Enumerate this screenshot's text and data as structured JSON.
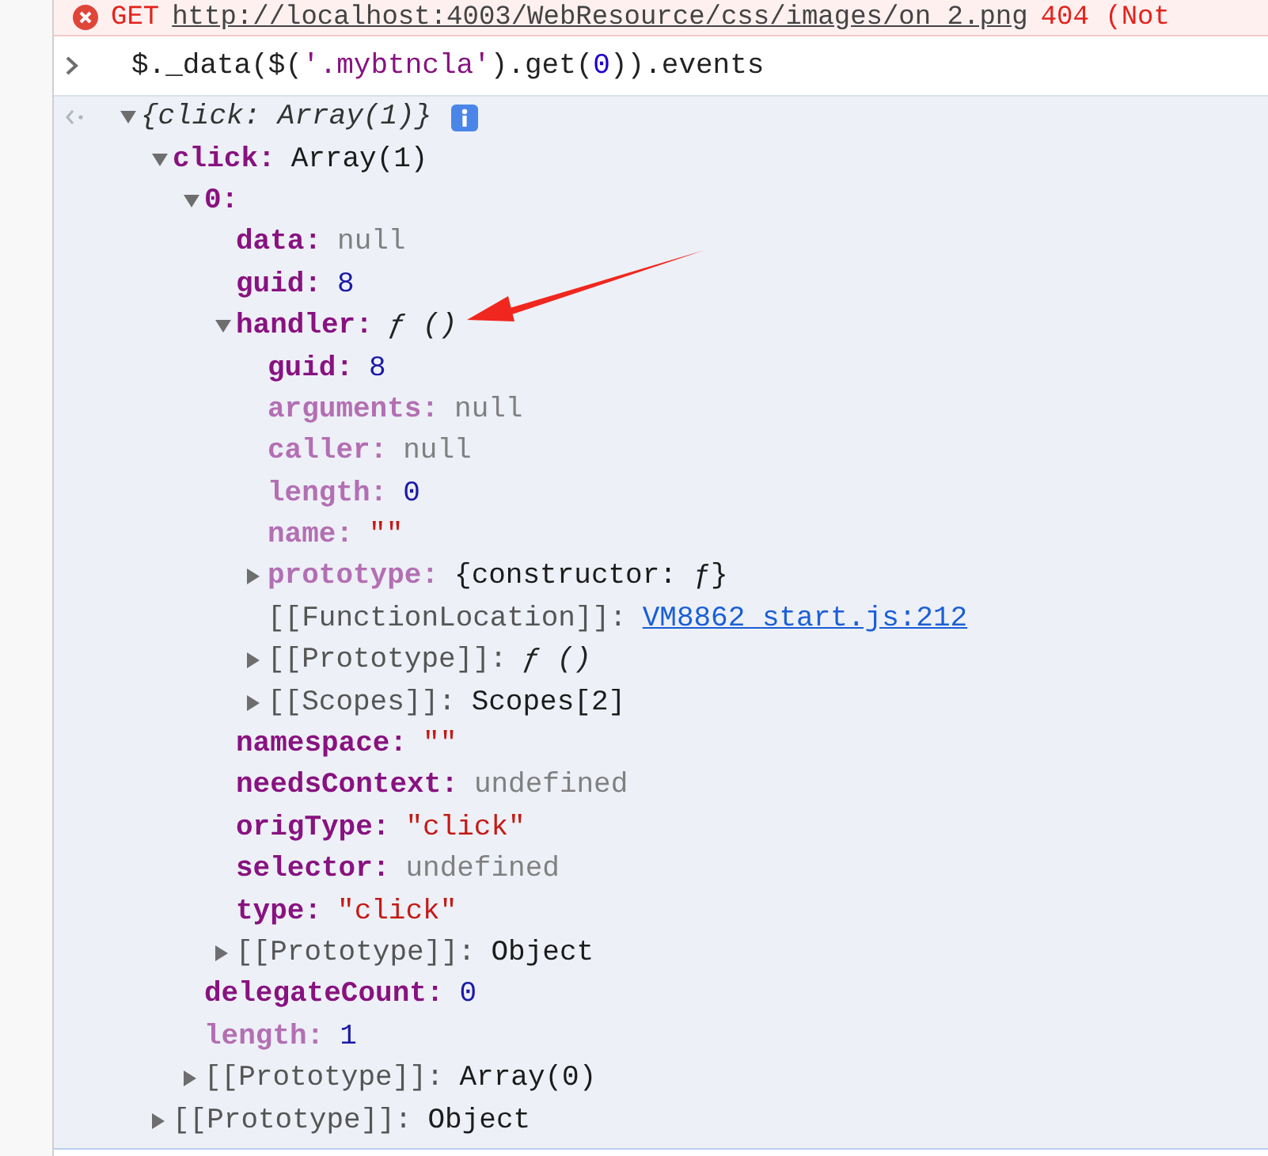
{
  "error": {
    "method": "GET",
    "url": "http://localhost:4003/WebResource/css/images/on_2.png",
    "status": "404 (Not"
  },
  "input": {
    "tokens": [
      {
        "text": "$._data($(",
        "kind": "plain"
      },
      {
        "text": "'.mybtncla'",
        "kind": "string"
      },
      {
        "text": ").get(",
        "kind": "plain"
      },
      {
        "text": "0",
        "kind": "number"
      },
      {
        "text": ")).events",
        "kind": "plain"
      }
    ]
  },
  "result": {
    "preview": "{click: Array(1)}",
    "expandable": true,
    "expanded": true,
    "info": true,
    "children": [
      {
        "key": "click:",
        "kind": "own",
        "value": {
          "text": "Array(1)",
          "kind": "object"
        },
        "expandable": true,
        "expanded": true,
        "children": [
          {
            "key": "0:",
            "kind": "own",
            "expandable": true,
            "expanded": true,
            "children": [
              {
                "key": "data:",
                "kind": "own",
                "value": {
                  "text": "null",
                  "kind": "null"
                },
                "expandable": false
              },
              {
                "key": "guid:",
                "kind": "own",
                "value": {
                  "text": "8",
                  "kind": "number"
                },
                "expandable": false
              },
              {
                "key": "handler:",
                "kind": "own",
                "value": {
                  "text": "ƒ ()",
                  "kind": "function"
                },
                "expandable": true,
                "expanded": true,
                "children": [
                  {
                    "key": "guid:",
                    "kind": "own",
                    "value": {
                      "text": "8",
                      "kind": "number"
                    },
                    "expandable": false
                  },
                  {
                    "key": "arguments:",
                    "kind": "inherited",
                    "value": {
                      "text": "null",
                      "kind": "null"
                    },
                    "expandable": false
                  },
                  {
                    "key": "caller:",
                    "kind": "inherited",
                    "value": {
                      "text": "null",
                      "kind": "null"
                    },
                    "expandable": false
                  },
                  {
                    "key": "length:",
                    "kind": "inherited",
                    "value": {
                      "text": "0",
                      "kind": "number"
                    },
                    "expandable": false
                  },
                  {
                    "key": "name:",
                    "kind": "inherited",
                    "value": {
                      "text": "\"\"",
                      "kind": "string"
                    },
                    "expandable": false
                  },
                  {
                    "key": "prototype:",
                    "kind": "inherited",
                    "value": {
                      "text": "{constructor: ƒ}",
                      "kind": "object"
                    },
                    "expandable": true,
                    "expanded": false
                  },
                  {
                    "key": "[[FunctionLocation]]:",
                    "kind": "internal",
                    "value": {
                      "text": "VM8862 start.js:212",
                      "kind": "link"
                    },
                    "expandable": false
                  },
                  {
                    "key": "[[Prototype]]:",
                    "kind": "internal",
                    "value": {
                      "text": "ƒ ()",
                      "kind": "function"
                    },
                    "expandable": true,
                    "expanded": false
                  },
                  {
                    "key": "[[Scopes]]:",
                    "kind": "internal",
                    "value": {
                      "text": "Scopes[2]",
                      "kind": "object"
                    },
                    "expandable": true,
                    "expanded": false
                  }
                ]
              },
              {
                "key": "namespace:",
                "kind": "own",
                "value": {
                  "text": "\"\"",
                  "kind": "string"
                },
                "expandable": false
              },
              {
                "key": "needsContext:",
                "kind": "own",
                "value": {
                  "text": "undefined",
                  "kind": "null"
                },
                "expandable": false
              },
              {
                "key": "origType:",
                "kind": "own",
                "value": {
                  "text": "\"click\"",
                  "kind": "string"
                },
                "expandable": false
              },
              {
                "key": "selector:",
                "kind": "own",
                "value": {
                  "text": "undefined",
                  "kind": "null"
                },
                "expandable": false
              },
              {
                "key": "type:",
                "kind": "own",
                "value": {
                  "text": "\"click\"",
                  "kind": "string"
                },
                "expandable": false
              },
              {
                "key": "[[Prototype]]:",
                "kind": "internal",
                "value": {
                  "text": "Object",
                  "kind": "object"
                },
                "expandable": true,
                "expanded": false
              }
            ]
          },
          {
            "key": "delegateCount:",
            "kind": "own",
            "value": {
              "text": "0",
              "kind": "number"
            },
            "expandable": false
          },
          {
            "key": "length:",
            "kind": "inherited",
            "value": {
              "text": "1",
              "kind": "number"
            },
            "expandable": false
          },
          {
            "key": "[[Prototype]]:",
            "kind": "internal",
            "value": {
              "text": "Array(0)",
              "kind": "object"
            },
            "expandable": true,
            "expanded": false
          }
        ]
      },
      {
        "key": "[[Prototype]]:",
        "kind": "internal",
        "value": {
          "text": "Object",
          "kind": "object"
        },
        "expandable": true,
        "expanded": false
      }
    ]
  }
}
